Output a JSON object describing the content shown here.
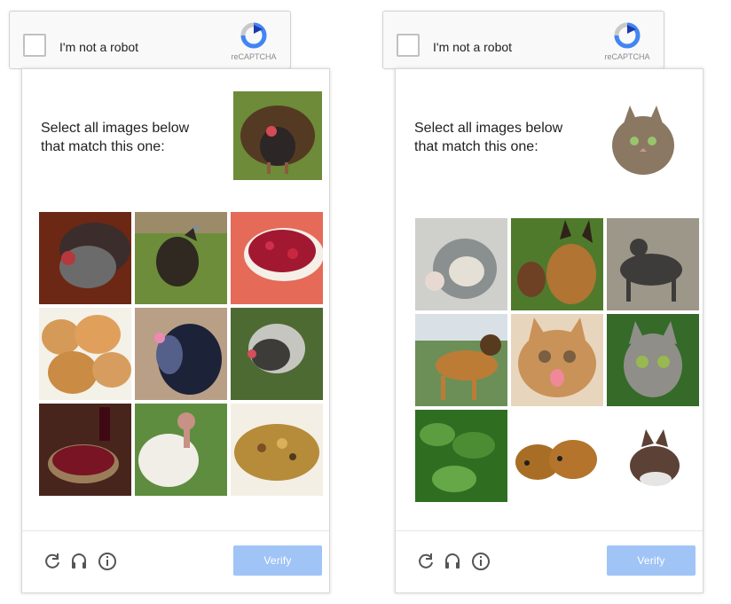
{
  "captchas": [
    {
      "checkbox_label": "I'm not a robot",
      "brand": "reCAPTCHA",
      "prompt_line_1": "Select all images below",
      "prompt_line_2": "that match this one:",
      "sample_image": "turkey",
      "tiles": [
        "turkey-display",
        "turkey-walking",
        "cranberry-bowl",
        "bread-rolls",
        "turkey-dark",
        "turkey-grass",
        "wine-cranberries",
        "turkey-white",
        "stuffing"
      ],
      "verify_label": "Verify",
      "footer_icons": [
        "reload-icon",
        "audio-icon",
        "info-icon"
      ]
    },
    {
      "checkbox_label": "I'm not a robot",
      "brand": "reCAPTCHA",
      "prompt_line_1": "Select all images below",
      "prompt_line_2": "that match this one:",
      "sample_image": "cat",
      "tiles": [
        "kitten-sleeping",
        "german-shepherd-puppy",
        "grey-dog",
        "german-shepherd",
        "kitten-cream",
        "tabby-kitten",
        "leafy-plant",
        "guinea-pigs",
        "kitten-small"
      ],
      "verify_label": "Verify",
      "footer_icons": [
        "reload-icon",
        "audio-icon",
        "info-icon"
      ]
    }
  ]
}
